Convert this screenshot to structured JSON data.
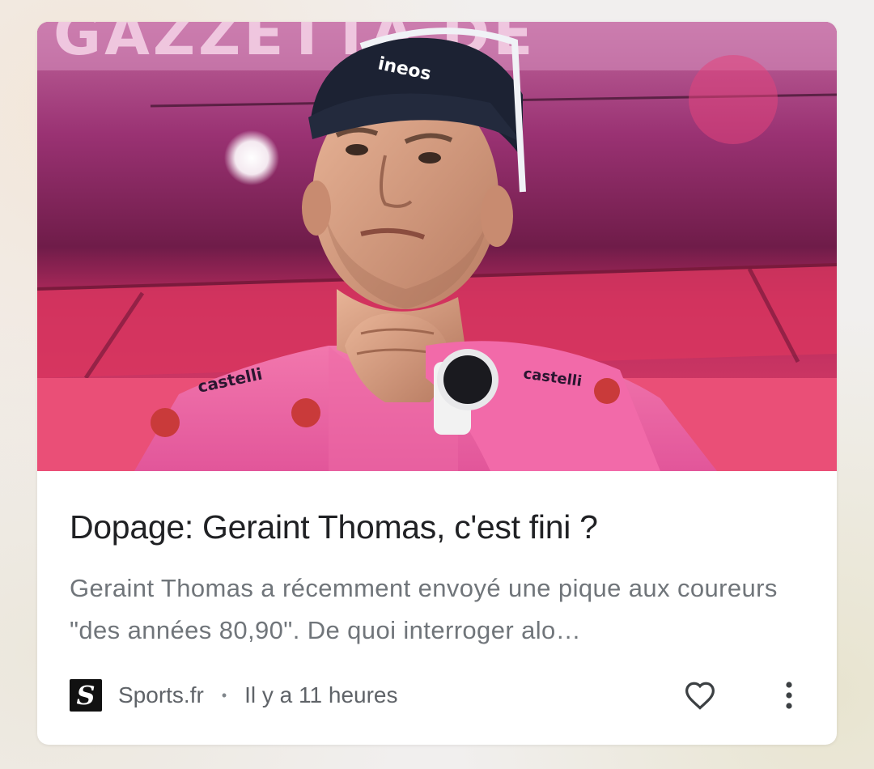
{
  "article": {
    "title": "Dopage: Geraint Thomas, c'est fini ?",
    "snippet": "Geraint Thomas a récemment envoyé une pique aux coureurs \"des années 80,90\". De quoi interroger alo…",
    "image_brand_text": "ineos",
    "image_sponsor_text": "castelli"
  },
  "source": {
    "logo_letter": "S",
    "name": "Sports.fr",
    "separator": "•",
    "time": "Il y a 11 heures"
  },
  "actions": {
    "like_icon": "heart-outline-icon",
    "more_icon": "more-vert-icon"
  },
  "colors": {
    "jersey_pink": "#e45a9a",
    "background_magenta": "#9b2f6b",
    "title_text": "#202124",
    "snippet_text": "#70757a"
  }
}
